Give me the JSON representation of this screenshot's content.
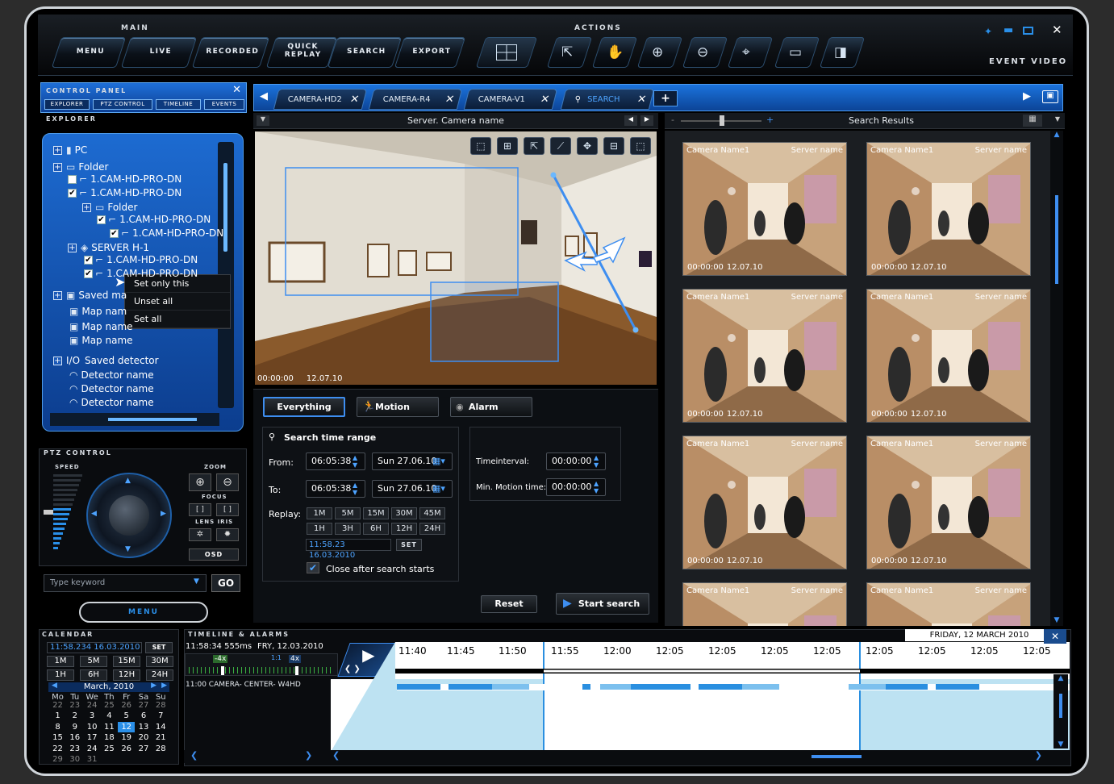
{
  "window": {
    "controls": [
      "pin-icon",
      "minimize-icon",
      "maximize-icon",
      "close-icon"
    ],
    "event_video": "EVENT VIDEO"
  },
  "main_group_label": "MAIN",
  "actions_group_label": "ACTIONS",
  "main_buttons": [
    "MENU",
    "LIVE",
    "RECORDED",
    "QUICK\nREPLAY",
    "SEARCH",
    "EXPORT"
  ],
  "action_icons": [
    "pointer-move-icon",
    "hand-icon",
    "zoom-in-icon",
    "zoom-out-icon",
    "fit-screen-icon",
    "monitor-icon",
    "layout-icon"
  ],
  "control_panel": {
    "title": "CONTROL PANEL",
    "tabs": [
      "EXPLORER",
      "PTZ CONTROL",
      "TIMELINE",
      "EVENTS"
    ],
    "explorer_header": "EXPLORER"
  },
  "tree": [
    {
      "label": "PC",
      "type": "pc",
      "expander": "+"
    },
    {
      "label": "Folder",
      "type": "folder",
      "expander": "+"
    },
    {
      "label": "1.CAM-HD-PRO-DN",
      "type": "camera",
      "checked": false
    },
    {
      "label": "1.CAM-HD-PRO-DN",
      "type": "camera",
      "checked": true
    },
    {
      "label": "Folder",
      "type": "folder",
      "expander": "+"
    },
    {
      "label": "1.CAM-HD-PRO-DN",
      "type": "camera",
      "checked": true
    },
    {
      "label": "1.CAM-HD-PRO-DN",
      "type": "camera",
      "checked": true
    },
    {
      "label": "SERVER H-1",
      "type": "server",
      "expander": "+"
    },
    {
      "label": "1.CAM-HD-PRO-DN",
      "type": "camera",
      "checked": true
    },
    {
      "label": "1.CAM-HD-PRO-DN",
      "type": "camera",
      "checked": true
    },
    {
      "label": "Saved ma",
      "type": "map",
      "expander": "+"
    },
    {
      "label": "Map nam",
      "type": "map"
    },
    {
      "label": "Map name",
      "type": "map"
    },
    {
      "label": "Map name",
      "type": "map"
    },
    {
      "label": "Saved detector",
      "prefix": "I/O",
      "type": "io",
      "expander": "+"
    },
    {
      "label": "Detector name",
      "type": "detector"
    },
    {
      "label": "Detector name",
      "type": "detector"
    },
    {
      "label": "Detector name",
      "type": "detector"
    }
  ],
  "context_menu": [
    "Set only this",
    "Unset all",
    "Set all"
  ],
  "ptz": {
    "title": "PTZ CONTROL",
    "speed": "SPEED",
    "zoom": "ZOOM",
    "focus": "FOCUS",
    "lens_iris": "LENS IRIS",
    "osd": "OSD",
    "speed_level": 0.55
  },
  "keyword": {
    "placeholder": "Type keyword",
    "go": "GO",
    "menu": "MENU"
  },
  "camera_tabs": [
    "CAMERA-HD2",
    "CAMERA-R4",
    "CAMERA-V1",
    "SEARCH"
  ],
  "camera_title": "Server. Camera name",
  "video_overlay": {
    "time": "00:00:00",
    "date": "12.07.10"
  },
  "search_results_title": "Search Results",
  "search_modes": [
    "Everything",
    "Motion",
    "Alarm"
  ],
  "time_range": {
    "title": "Search time range",
    "from_label": "From:",
    "to_label": "To:",
    "from_time": "06:05:38",
    "from_date": "Sun 27.06.10",
    "to_time": "06:05:38",
    "to_date": "Sun 27.06.10",
    "replay_label": "Replay:",
    "replay_minutes": [
      "1M",
      "5M",
      "15M",
      "30M",
      "45M"
    ],
    "replay_hours": [
      "1H",
      "3H",
      "6H",
      "12H",
      "24H"
    ],
    "replay_datetime": "11:58.23  16.03.2010",
    "set": "SET",
    "close_after": "Close after search starts",
    "close_after_checked": true
  },
  "interval": {
    "timeinterval_label": "Timeinterval:",
    "timeinterval": "00:00:00",
    "min_motion_label": "Min. Motion time:",
    "min_motion": "00:00:00"
  },
  "buttons": {
    "reset": "Reset",
    "start_search": "Start search"
  },
  "results": [
    {
      "camera": "Camera Name1",
      "server": "Server name",
      "time": "00:00:00",
      "date": "12.07.10"
    },
    {
      "camera": "Camera Name1",
      "server": "Server name",
      "time": "00:00:00",
      "date": "12.07.10"
    },
    {
      "camera": "Camera Name1",
      "server": "Server name",
      "time": "00:00:00",
      "date": "12.07.10"
    },
    {
      "camera": "Camera Name1",
      "server": "Server name",
      "time": "00:00:00",
      "date": "12.07.10"
    },
    {
      "camera": "Camera Name1",
      "server": "Server name",
      "time": "00:00:00",
      "date": "12.07.10"
    },
    {
      "camera": "Camera Name1",
      "server": "Server name",
      "time": "00:00:00",
      "date": "12.07.10"
    },
    {
      "camera": "Camera Name1",
      "server": "Server name"
    },
    {
      "camera": "Camera Name1",
      "server": "Server name"
    }
  ],
  "calendar": {
    "title": "CALENDAR",
    "datetime": "11:58.234  16.03.2010",
    "set": "SET",
    "ranges": [
      "1M",
      "5M",
      "15M",
      "30M",
      "1H",
      "6H",
      "12H",
      "24H"
    ],
    "month": "March, 2010",
    "weekdays": [
      "Mo",
      "Tu",
      "We",
      "Th",
      "Fr",
      "Sa",
      "Su"
    ],
    "weeks": [
      [
        "1",
        "2",
        "3",
        "4",
        "5",
        "6",
        "7"
      ],
      [
        "8",
        "9",
        "10",
        "11",
        "12",
        "13",
        "14"
      ],
      [
        "15",
        "16",
        "17",
        "18",
        "19",
        "20",
        "21"
      ],
      [
        "22",
        "23",
        "24",
        "25",
        "26",
        "27",
        "28"
      ],
      [
        "29",
        "30",
        "31",
        "",
        "",
        "",
        ""
      ]
    ],
    "leading": [
      "22",
      "23",
      "24",
      "25",
      "26",
      "27",
      "28"
    ],
    "selected": "12"
  },
  "timeline": {
    "title": "TIMELINE & ALARMS",
    "clock": "11:58:34 555ms",
    "date": "FRY, 12.03.2010",
    "speed_left": "-4x",
    "speed_right": "4x",
    "ratio": "1:1",
    "channel": "11:00  CAMERA- CENTER- W4HD",
    "day_label": "FRIDAY,  12  MARCH  2010",
    "ticks": [
      "11:40",
      "11:45",
      "11:50",
      "11:55",
      "12:00",
      "12:05",
      "12:05",
      "12:05",
      "12:05",
      "12:05",
      "12:05",
      "12:05",
      "12:05"
    ]
  }
}
